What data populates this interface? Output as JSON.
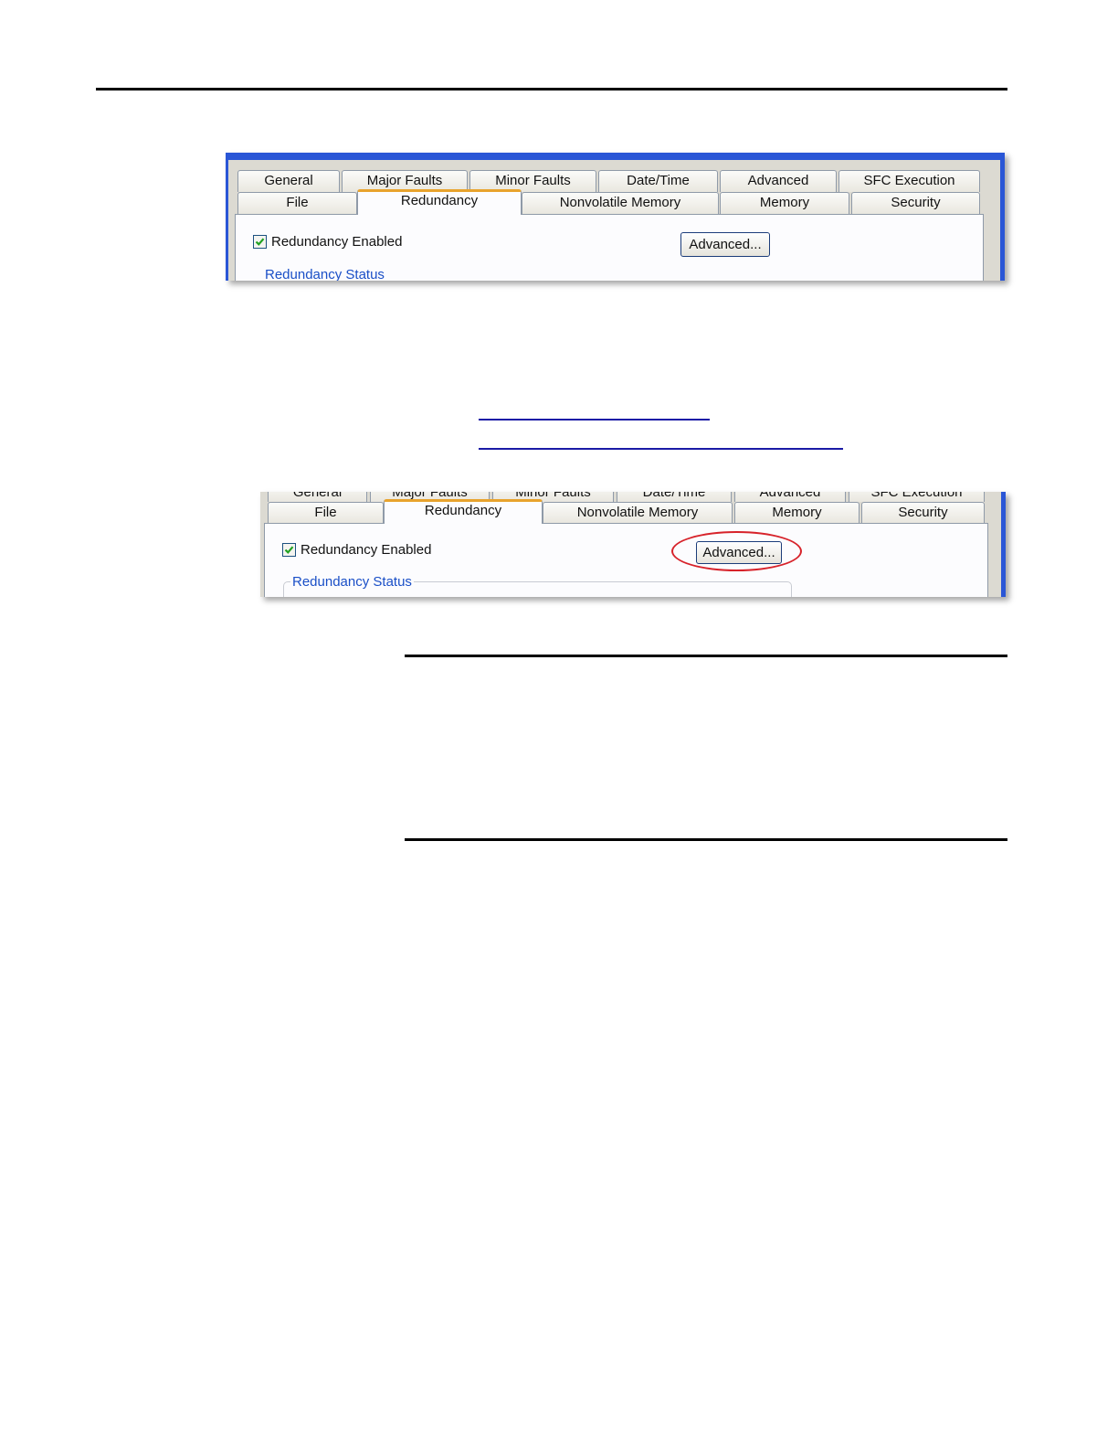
{
  "dialog": {
    "tabs_row1": [
      "General",
      "Major Faults",
      "Minor Faults",
      "Date/Time",
      "Advanced",
      "SFC Execution"
    ],
    "tabs_row2": [
      "File",
      "Redundancy",
      "Nonvolatile Memory",
      "Memory",
      "Security"
    ],
    "active_tab": "Redundancy",
    "redundancy_enabled_label": "Redundancy Enabled",
    "redundancy_enabled_checked": true,
    "advanced_button": "Advanced...",
    "redundancy_status_label": "Redundancy Status"
  },
  "colors": {
    "window_frame": "#2a56d6",
    "active_tab_accent": "#e8a32d",
    "status_text": "#1a4fc7",
    "callout_oval": "#d7222a"
  }
}
